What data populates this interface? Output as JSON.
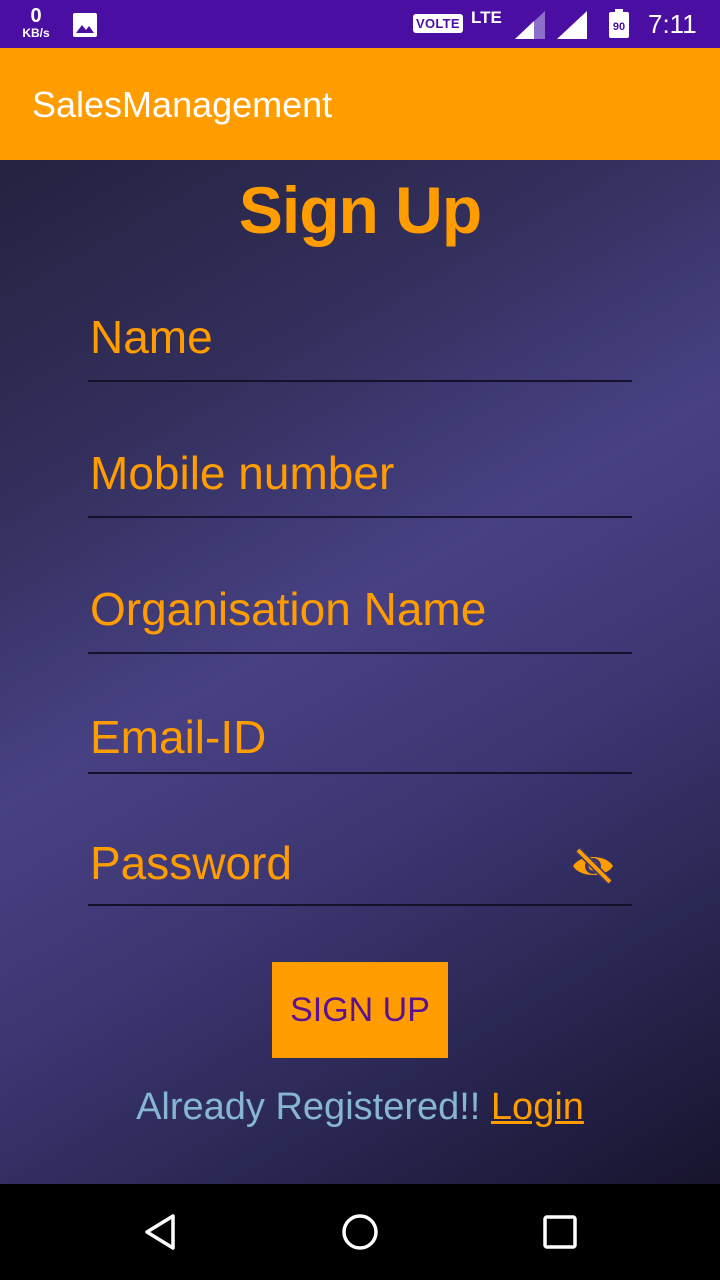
{
  "status_bar": {
    "net_speed_value": "0",
    "net_speed_unit": "KB/s",
    "volte": "VOLTE",
    "network": "LTE",
    "battery": "90",
    "time": "7:11",
    "icons": [
      "image-notification-icon",
      "signal-icon",
      "battery-icon"
    ]
  },
  "app_bar": {
    "title": "SalesManagement"
  },
  "form": {
    "heading": "Sign Up",
    "fields": [
      {
        "placeholder": "Name"
      },
      {
        "placeholder": "Mobile number"
      },
      {
        "placeholder": "Organisation Name"
      },
      {
        "placeholder": "Email-ID"
      },
      {
        "placeholder": "Password"
      }
    ],
    "submit_label": "SIGN UP",
    "already_text": "Already Registered!! ",
    "login_link": "Login"
  },
  "nav_bar": {
    "icons": [
      "back-icon",
      "home-icon",
      "recent-apps-icon"
    ]
  },
  "colors": {
    "status_bar": "#4a0ea3",
    "accent": "#ff9c00",
    "button_text": "#5b1291",
    "hint_text": "#86b6d4"
  }
}
